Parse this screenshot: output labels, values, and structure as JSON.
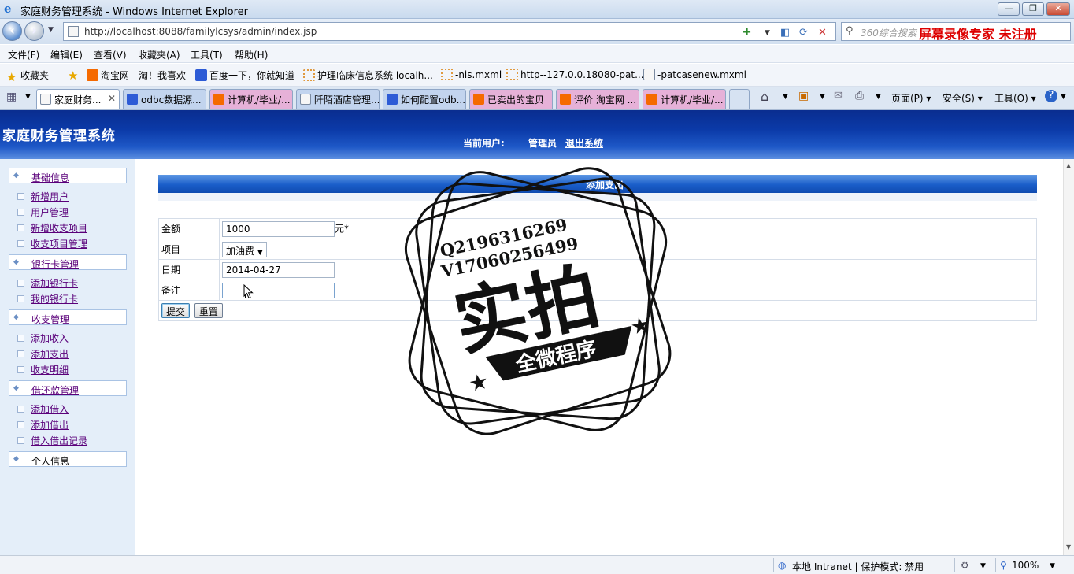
{
  "window": {
    "title": "家庭财务管理系统 - Windows Internet Explorer",
    "min_label": "—",
    "max_label": "❐",
    "close_label": "✕"
  },
  "addressbar": {
    "url": "http://localhost:8088/familylcsys/admin/index.jsp",
    "search_placeholder": "360综合搜索",
    "promo_text": "屏幕录像专家  未注册"
  },
  "menu": [
    "文件(F)",
    "编辑(E)",
    "查看(V)",
    "收藏夹(A)",
    "工具(T)",
    "帮助(H)"
  ],
  "favorites": {
    "label": "收藏夹",
    "items": [
      "淘宝网 - 淘！我喜欢",
      "百度一下，你就知道",
      "护理临床信息系统 localh...",
      "-nis.mxml",
      "http--127.0.0.18080-pat...",
      "-patcasenew.mxml"
    ]
  },
  "tabs": [
    "家庭财务...",
    "odbc数据源...",
    "计算机/毕业/...",
    "阡陌酒店管理...",
    "如何配置odb...",
    "已卖出的宝贝",
    "评价 淘宝网 ...",
    "计算机/毕业/..."
  ],
  "toolbar": {
    "page": "页面(P)",
    "safety": "安全(S)",
    "tools": "工具(O)"
  },
  "header": {
    "system_title": "家庭财务管理系统",
    "current_user_label": "当前用户:",
    "user_name": "管理员",
    "logout": "退出系统"
  },
  "sidebar": {
    "sections": [
      {
        "title": "基础信息",
        "items": [
          "新增用户",
          "用户管理",
          "新增收支项目",
          "收支项目管理"
        ]
      },
      {
        "title": "银行卡管理",
        "items": [
          "添加银行卡",
          "我的银行卡"
        ]
      },
      {
        "title": "收支管理",
        "items": [
          "添加收入",
          "添加支出",
          "收支明细"
        ]
      },
      {
        "title": "借还款管理",
        "items": [
          "添加借入",
          "添加借出",
          "借入借出记录"
        ]
      },
      {
        "title": "个人信息",
        "items": []
      }
    ]
  },
  "form": {
    "section_title": "添加支出",
    "amount_label": "金额",
    "amount_value": "1000",
    "amount_unit": "元*",
    "item_label": "项目",
    "item_value": "加油费",
    "date_label": "日期",
    "date_value": "2014-04-27",
    "note_label": "备注",
    "note_value": "",
    "submit": "提交",
    "reset": "重置"
  },
  "watermark": {
    "qq": "Q2196316269",
    "wx": "V17060256499",
    "big": "实拍",
    "ribbon": "全微程序"
  },
  "statusbar": {
    "zone": "本地 Intranet | 保护模式: 禁用",
    "zoom": "100%"
  }
}
